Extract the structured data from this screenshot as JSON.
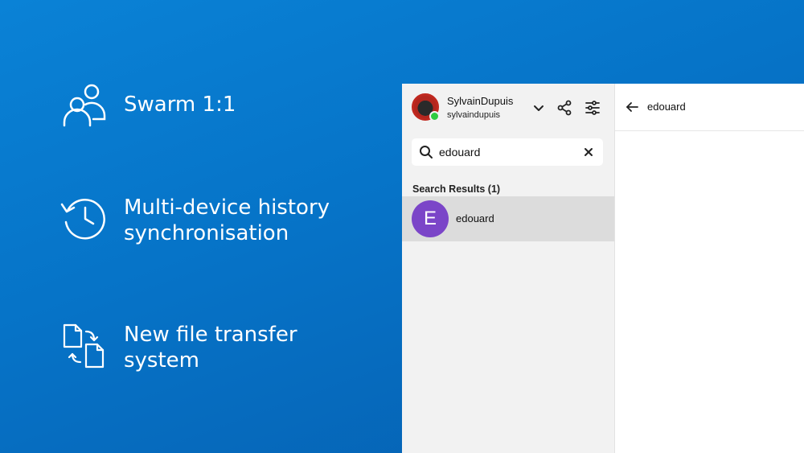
{
  "features": [
    {
      "icon": "users-icon",
      "text": "Swarm 1:1"
    },
    {
      "icon": "history-icon",
      "text": "Multi-device history\nsynchronisation"
    },
    {
      "icon": "file-transfer-icon",
      "text": "New file transfer\nsystem"
    }
  ],
  "account": {
    "display_name": "SylvainDupuis",
    "username": "sylvaindupuis",
    "status": "online"
  },
  "header_buttons": [
    "chevron-down-icon",
    "share-icon",
    "settings-sliders-icon"
  ],
  "search": {
    "value": "edouard",
    "placeholder": ""
  },
  "results": {
    "title": "Search Results (1)",
    "items": [
      {
        "initial": "E",
        "name": "edouard",
        "avatar_color": "#7b45c8"
      }
    ]
  },
  "conversation": {
    "title": "edouard"
  },
  "colors": {
    "background_start": "#0a82d6",
    "background_end": "#055fb0",
    "sidebar": "#f2f2f2",
    "selected_row": "#dcdcdc",
    "presence": "#2ecc40"
  }
}
